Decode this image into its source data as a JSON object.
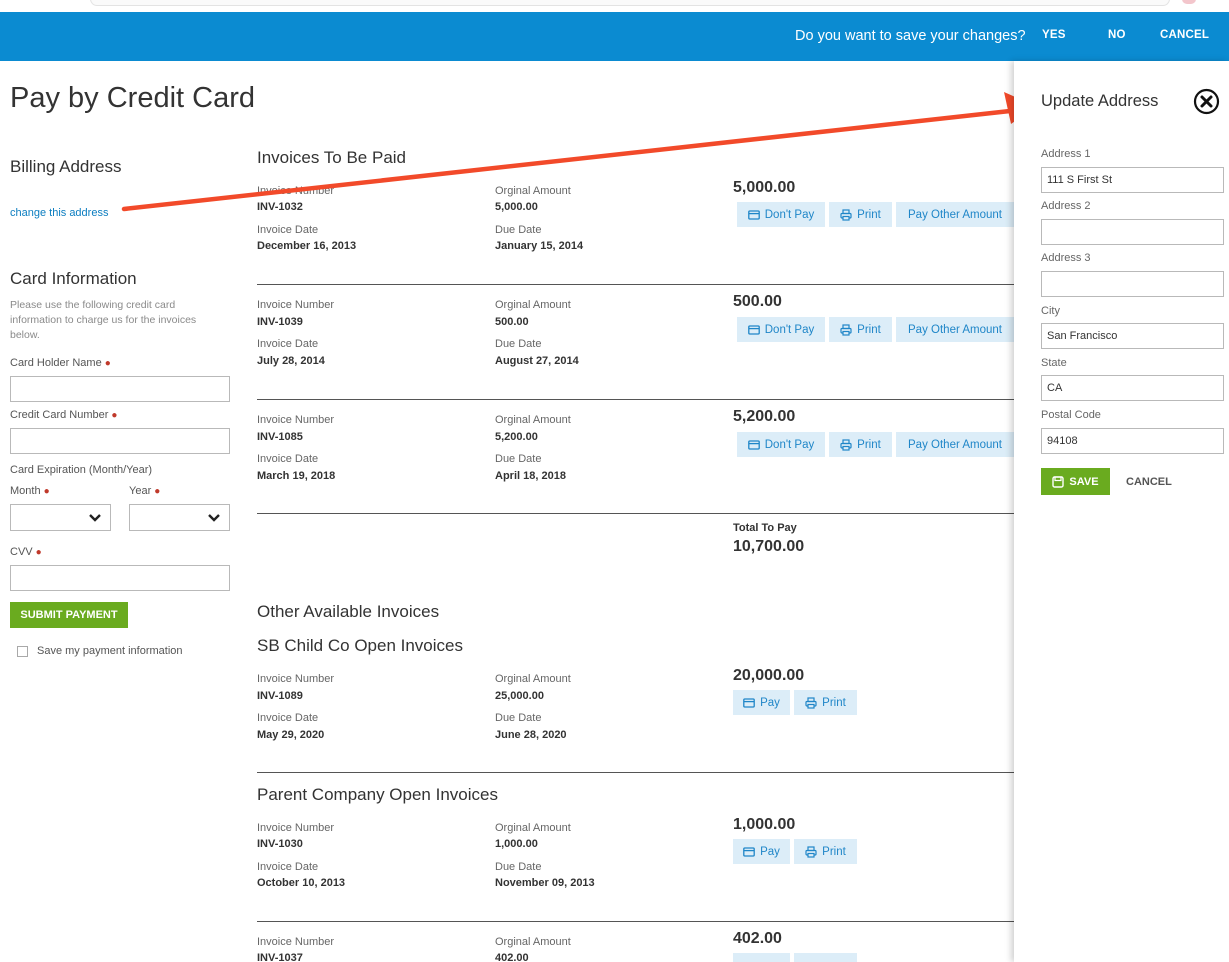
{
  "save_bar": {
    "question": "Do you want to save your changes?",
    "yes": "YES",
    "no": "NO",
    "cancel": "CANCEL"
  },
  "page": {
    "title": "Pay by Credit Card"
  },
  "billing": {
    "title": "Billing Address",
    "change_link": "change this address"
  },
  "card": {
    "title": "Card Information",
    "help": "Please use the following credit card information to charge us for the invoices below.",
    "holder_label": "Card Holder Name",
    "number_label": "Credit Card Number",
    "expiration_label": "Card Expiration (Month/Year)",
    "month_label": "Month",
    "year_label": "Year",
    "cvv_label": "CVV",
    "required_mark": "●",
    "submit": "SUBMIT PAYMENT",
    "save_info": "Save my payment information"
  },
  "labels": {
    "invoice_number": "Invoice Number",
    "original_amount": "Orginal Amount",
    "invoice_date": "Invoice Date",
    "due_date": "Due Date",
    "dont_pay": "Don't Pay",
    "print": "Print",
    "pay_other": "Pay Other Amount",
    "pay": "Pay"
  },
  "to_be_paid": {
    "title": "Invoices To Be Paid",
    "invoices": [
      {
        "number": "INV-1032",
        "original": "5,000.00",
        "date": "December 16, 2013",
        "due": "January 15, 2014",
        "amount": "5,000.00"
      },
      {
        "number": "INV-1039",
        "original": "500.00",
        "date": "July 28, 2014",
        "due": "August 27, 2014",
        "amount": "500.00"
      },
      {
        "number": "INV-1085",
        "original": "5,200.00",
        "date": "March 19, 2018",
        "due": "April 18, 2018",
        "amount": "5,200.00"
      }
    ],
    "total_label": "Total To Pay",
    "total": "10,700.00"
  },
  "other": {
    "title": "Other Available Invoices",
    "child": {
      "title": "SB Child Co Open Invoices",
      "invoice": {
        "number": "INV-1089",
        "original": "25,000.00",
        "date": "May 29, 2020",
        "due": "June 28, 2020",
        "amount": "20,000.00"
      }
    },
    "parent": {
      "title": "Parent Company Open Invoices",
      "invoices": [
        {
          "number": "INV-1030",
          "original": "1,000.00",
          "date": "October 10, 2013",
          "due": "November 09, 2013",
          "amount": "1,000.00"
        },
        {
          "number": "INV-1037",
          "original": "402.00",
          "amount": "402.00"
        }
      ]
    }
  },
  "panel": {
    "title": "Update Address",
    "address1_label": "Address 1",
    "address1": "111 S First St",
    "address2_label": "Address 2",
    "address2": "",
    "address3_label": "Address 3",
    "address3": "",
    "city_label": "City",
    "city": "San Francisco",
    "state_label": "State",
    "state": "CA",
    "postal_label": "Postal Code",
    "postal": "94108",
    "save": "SAVE",
    "cancel": "CANCEL"
  },
  "colors": {
    "primary_blue": "#0b8bd1",
    "green": "#6aab1f",
    "light_button": "#dcedf8",
    "link": "#0b7dc0",
    "annotation_arrow": "#f24a2a"
  }
}
